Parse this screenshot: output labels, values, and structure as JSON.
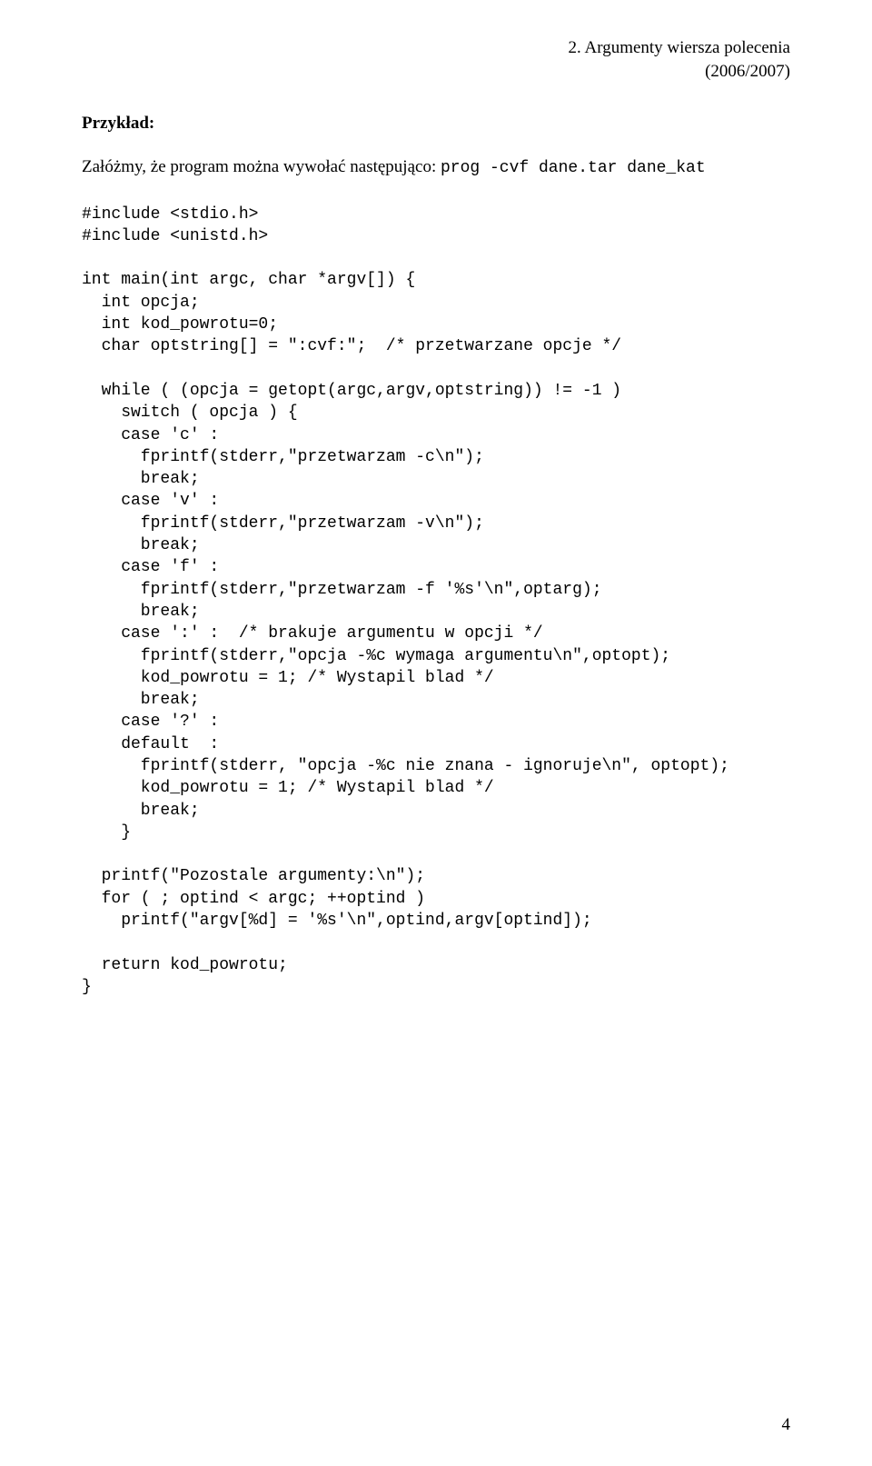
{
  "header": {
    "line1": "2. Argumenty wiersza polecenia",
    "line2": "(2006/2007)"
  },
  "section_title": "Przykład:",
  "intro": {
    "text": "Załóżmy, że program można wywołać następująco: ",
    "code": "prog -cvf dane.tar dane_kat"
  },
  "code": "#include <stdio.h>\n#include <unistd.h>\n\nint main(int argc, char *argv[]) {\n  int opcja;\n  int kod_powrotu=0;\n  char optstring[] = \":cvf:\";  /* przetwarzane opcje */\n\n  while ( (opcja = getopt(argc,argv,optstring)) != -1 )\n    switch ( opcja ) {\n    case 'c' :\n      fprintf(stderr,\"przetwarzam -c\\n\");\n      break;\n    case 'v' :\n      fprintf(stderr,\"przetwarzam -v\\n\");\n      break;\n    case 'f' :\n      fprintf(stderr,\"przetwarzam -f '%s'\\n\",optarg);\n      break;\n    case ':' :  /* brakuje argumentu w opcji */\n      fprintf(stderr,\"opcja -%c wymaga argumentu\\n\",optopt);\n      kod_powrotu = 1; /* Wystapil blad */\n      break;\n    case '?' :\n    default  :\n      fprintf(stderr, \"opcja -%c nie znana - ignoruje\\n\", optopt);\n      kod_powrotu = 1; /* Wystapil blad */\n      break;\n    }\n\n  printf(\"Pozostale argumenty:\\n\");\n  for ( ; optind < argc; ++optind )\n    printf(\"argv[%d] = '%s'\\n\",optind,argv[optind]);\n\n  return kod_powrotu;\n}",
  "page_number": "4"
}
